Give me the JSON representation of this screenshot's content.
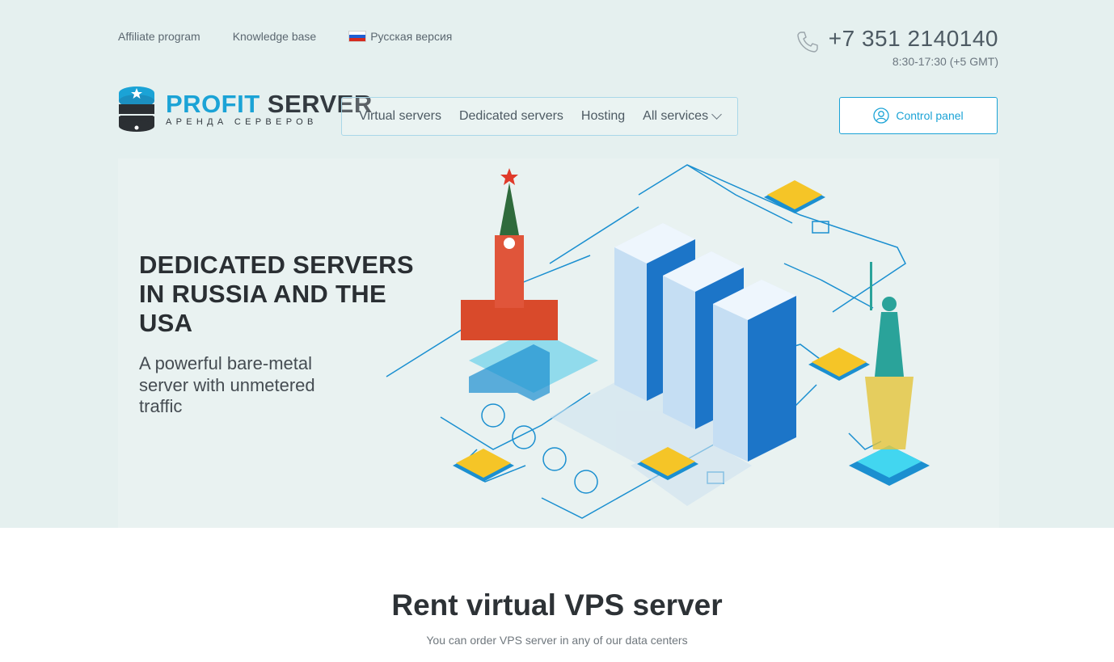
{
  "toplinks": {
    "affiliate": "Affiliate program",
    "knowledge": "Knowledge base",
    "russian": "Русская версия"
  },
  "contact": {
    "phone": "+7 351 2140140",
    "hours": "8:30-17:30 (+5 GMT)"
  },
  "logo": {
    "word1": "PROFIT",
    "word2": "SERVER",
    "tagline": "АРЕНДА СЕРВЕРОВ"
  },
  "nav": {
    "virtual": "Virtual servers",
    "dedicated": "Dedicated servers",
    "hosting": "Hosting",
    "all": "All services"
  },
  "control_panel": {
    "label": "Control panel"
  },
  "hero": {
    "title": "DEDICATED SERVERS IN RUSSIA AND THE USA",
    "subtitle": "A powerful bare-metal server with unmetered traffic"
  },
  "section": {
    "title": "Rent virtual VPS server",
    "subtitle": "You can order VPS server in any of our data centers"
  },
  "colors": {
    "accent": "#1ba3d6",
    "band": "#e5f0ef",
    "text_dark": "#2a2f33"
  }
}
